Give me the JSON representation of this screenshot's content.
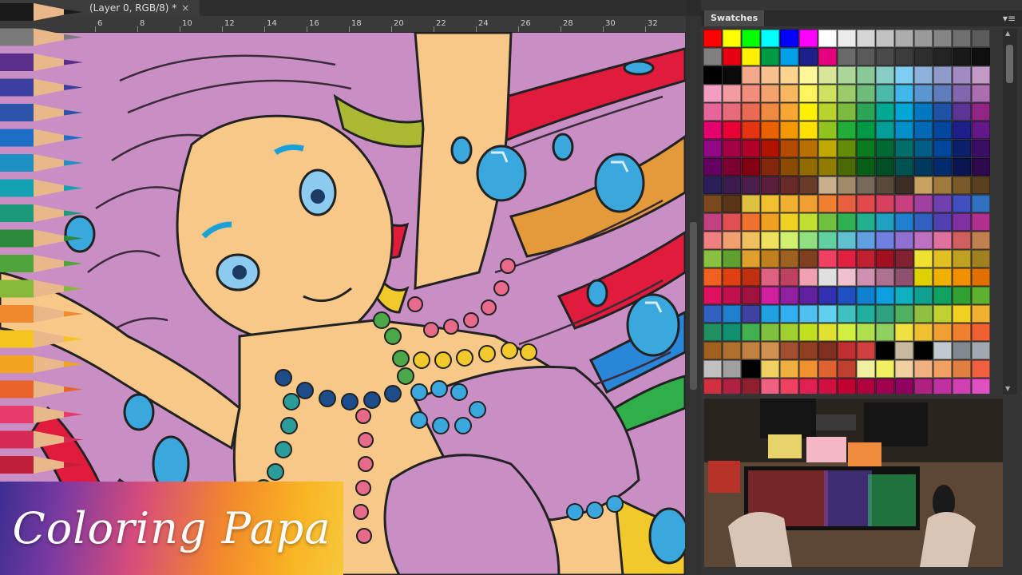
{
  "document": {
    "tab_title": "(Layer 0, RGB/8) *",
    "close_symbol": "×"
  },
  "ruler": {
    "ticks": [
      "6",
      "8",
      "10",
      "12",
      "14",
      "16",
      "18",
      "20",
      "22",
      "24",
      "26",
      "28",
      "30",
      "32"
    ]
  },
  "panel": {
    "tab_label": "Swatches",
    "menu_symbol": "▾≡"
  },
  "brand": {
    "text": "Coloring Papa"
  },
  "colors": {
    "hair": "#c98fc5",
    "skin": "#f8c888",
    "bead_blue": "#3aa7de"
  },
  "swatch_rows": [
    [
      "#ff0000",
      "#ffff00",
      "#00ff00",
      "#00ffff",
      "#0000ff",
      "#ff00ff",
      "#ffffff",
      "#ebebeb",
      "#d6d6d6",
      "#c2c2c2",
      "#adadad",
      "#999999",
      "#858585",
      "#707070",
      "#5c5c5c"
    ],
    [
      "#808080",
      "#e60012",
      "#fff100",
      "#009944",
      "#00a0e9",
      "#1d2088",
      "#e4007f",
      "#6a6a6a",
      "#5a5a5a",
      "#4a4a4a",
      "#3c3c3c",
      "#2f2f2f",
      "#232323",
      "#181818",
      "#0f0f0f"
    ],
    [
      "#000000",
      "#0a0a0a",
      "#f5a98b",
      "#f9c08f",
      "#fcd48f",
      "#fff699",
      "#d7e698",
      "#acd598",
      "#89c997",
      "#87cdc6",
      "#7ecef4",
      "#8fb2dd",
      "#8f9ccb",
      "#a08cc3",
      "#c39ac6"
    ],
    [
      "#f19ec2",
      "#f29c9f",
      "#f08e7b",
      "#f5a36e",
      "#f8b862",
      "#fff45c",
      "#cfe260",
      "#9ccc6a",
      "#6fbb7a",
      "#4db9a8",
      "#41b7e9",
      "#5a97d1",
      "#5f7cbd",
      "#8267ae",
      "#ac6eae"
    ],
    [
      "#e6669b",
      "#e96a78",
      "#ea6a54",
      "#f08941",
      "#f8a832",
      "#fff100",
      "#b6d22b",
      "#7cbb3f",
      "#2ba456",
      "#00a98f",
      "#00a7d6",
      "#0078c0",
      "#1e53a5",
      "#5c3594",
      "#922685"
    ],
    [
      "#e4006f",
      "#e60033",
      "#e63312",
      "#eb6100",
      "#f39800",
      "#ffe000",
      "#8fc31f",
      "#22ac38",
      "#009944",
      "#009e96",
      "#0090c9",
      "#0068b7",
      "#00479d",
      "#1d2088",
      "#601986"
    ],
    [
      "#920783",
      "#a40046",
      "#b0002a",
      "#b01300",
      "#b34a00",
      "#b86e00",
      "#bfa800",
      "#638c0b",
      "#0b7c1e",
      "#006934",
      "#006f6b",
      "#005d86",
      "#00469b",
      "#0b1f6b",
      "#3b0e66"
    ],
    [
      "#630061",
      "#7c0032",
      "#830012",
      "#82270b",
      "#8b4b00",
      "#8f6b00",
      "#907d00",
      "#4a6a06",
      "#095e17",
      "#004d26",
      "#005151",
      "#00395f",
      "#002b6e",
      "#0a1451",
      "#2e0a4c"
    ],
    [
      "#2a1f5a",
      "#3b1a4c",
      "#4a1f4c",
      "#5a1f3c",
      "#6a2a2a",
      "#6a3a2a",
      "#c8b08c",
      "#a08a6a",
      "#786a5a",
      "#5a4a3a",
      "#3c2e24",
      "#c8a060",
      "#a07a3a",
      "#7a5a2a",
      "#5a4020"
    ],
    [
      "#7a4a1e",
      "#5a3416",
      "#e0c040",
      "#f0c030",
      "#f0b030",
      "#f0a030",
      "#f08030",
      "#e86040",
      "#e04a4a",
      "#d84060",
      "#c84080",
      "#a040a0",
      "#7040b0",
      "#4050c0",
      "#3070c0"
    ],
    [
      "#c04080",
      "#e05050",
      "#f07030",
      "#f0a020",
      "#f0d020",
      "#c0e030",
      "#70c040",
      "#30b050",
      "#20b090",
      "#20a0c0",
      "#2080d0",
      "#3060c0",
      "#5040b0",
      "#8030a0",
      "#b03090"
    ],
    [
      "#f08080",
      "#f0a070",
      "#f0c060",
      "#f0e060",
      "#d0f070",
      "#90e080",
      "#60d0a0",
      "#60c0d0",
      "#60a0e0",
      "#7080e0",
      "#9070d0",
      "#c070c0",
      "#e070a0",
      "#d06060",
      "#c08050"
    ],
    [
      "#8ac040",
      "#60a030",
      "#e0a030",
      "#c08020",
      "#a06020",
      "#804020",
      "#f04060",
      "#e02040",
      "#c02030",
      "#a01020",
      "#802030",
      "#f0e030",
      "#e0c020",
      "#c0a020",
      "#a08020"
    ],
    [
      "#f06020",
      "#e04010",
      "#c03010",
      "#e06080",
      "#c04060",
      "#f0a0b0",
      "#e0e0e0",
      "#f0c0d0",
      "#d090b0",
      "#b07090",
      "#905070",
      "#e0d000",
      "#f0b000",
      "#f09000",
      "#e07000"
    ],
    [
      "#e01060",
      "#c01050",
      "#a01040",
      "#d020a0",
      "#9020a0",
      "#6020a0",
      "#3030b0",
      "#2050c0",
      "#1080d0",
      "#10a0e0",
      "#10b0c0",
      "#10a090",
      "#10a060",
      "#30a030",
      "#60b030"
    ],
    [
      "#3060c0",
      "#2080d0",
      "#4040a0",
      "#20a0e0",
      "#30b0f0",
      "#50c0f0",
      "#60d0f0",
      "#40c0c0",
      "#20b0a0",
      "#30a080",
      "#50b060",
      "#90c040",
      "#c0d030",
      "#f0d020",
      "#f0b030"
    ],
    [
      "#209060",
      "#109070",
      "#40b050",
      "#80c040",
      "#a0d030",
      "#c0e020",
      "#e0e030",
      "#d0f040",
      "#b0e050",
      "#90d060",
      "#f0e040",
      "#f0c030",
      "#f0a030",
      "#f08030",
      "#f06030"
    ],
    [
      "#a06020",
      "#b07030",
      "#c08040",
      "#d09050",
      "#a05030",
      "#904020",
      "#803020",
      "#c03030",
      "#d04040",
      "#000000",
      "#c8b8a0",
      "#000000",
      "#c0c8d0",
      "#808890",
      "#a0a8b0"
    ],
    [
      "#c0c0c0",
      "#a0a0a0",
      "#000000",
      "#f0d060",
      "#f0b040",
      "#f09030",
      "#e06030",
      "#c04030",
      "#f0f0a0",
      "#f0f060",
      "#f0d0a0",
      "#f0b080",
      "#f0a060",
      "#e08040",
      "#f06040"
    ],
    [
      "#d03040",
      "#b02040",
      "#902030",
      "#f06080",
      "#f04060",
      "#e02050",
      "#d01040",
      "#c00030",
      "#b00040",
      "#a00050",
      "#900060",
      "#b02080",
      "#c030a0",
      "#d040b0",
      "#e050c0"
    ]
  ]
}
